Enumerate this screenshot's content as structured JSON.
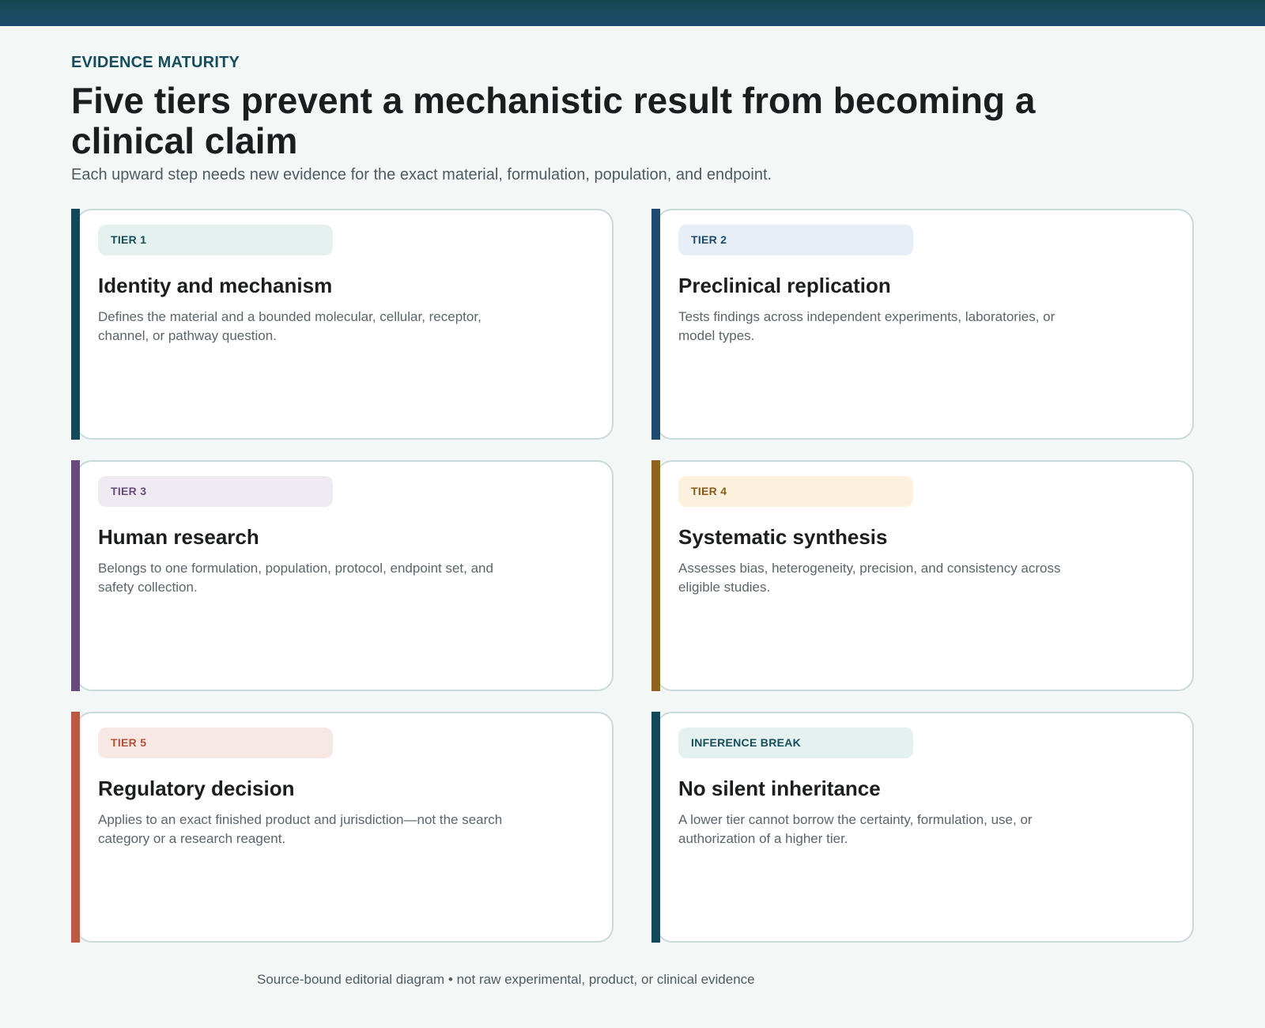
{
  "header": {
    "eyebrow": "EVIDENCE MATURITY",
    "title": "Five tiers prevent a mechanistic result from becoming a clinical claim",
    "subtitle": "Each upward step needs new evidence for the exact material, formulation, population, and endpoint."
  },
  "cards": [
    {
      "badge": "TIER 1",
      "title": "Identity and mechanism",
      "description": "Defines the material and a bounded molecular, cellular, receptor, channel, or pathway question.",
      "accent_color": "#13475a",
      "badge_bg": "#e5f1ef",
      "badge_text_color": "#164d5c"
    },
    {
      "badge": "TIER 2",
      "title": "Preclinical replication",
      "description": "Tests findings across independent experiments, laboratories, or model types.",
      "accent_color": "#1f4a6e",
      "badge_bg": "#e6eff7",
      "badge_text_color": "#1f4a6e"
    },
    {
      "badge": "TIER 3",
      "title": "Human research",
      "description": "Belongs to one formulation, population, protocol, endpoint set, and safety collection.",
      "accent_color": "#6a4a7e",
      "badge_bg": "#efe9f1",
      "badge_text_color": "#6a4a7e"
    },
    {
      "badge": "TIER 4",
      "title": "Systematic synthesis",
      "description": "Assesses bias, heterogeneity, precision, and consistency across eligible studies.",
      "accent_color": "#8f6220",
      "badge_bg": "#fdf1dd",
      "badge_text_color": "#8a5c1a"
    },
    {
      "badge": "TIER 5",
      "title": "Regulatory decision",
      "description": "Applies to an exact finished product and jurisdiction—not the search category or a research reagent.",
      "accent_color": "#b85c41",
      "badge_bg": "#f8e8e3",
      "badge_text_color": "#b05237"
    },
    {
      "badge": "INFERENCE BREAK",
      "title": "No silent inheritance",
      "description": "A lower tier cannot borrow the certainty, formulation, use, or authorization of a higher tier.",
      "accent_color": "#13475a",
      "badge_bg": "#e5f1ef",
      "badge_text_color": "#164d5c"
    }
  ],
  "footer": {
    "note": "Source-bound editorial diagram • not raw experimental, product, or clinical evidence"
  }
}
